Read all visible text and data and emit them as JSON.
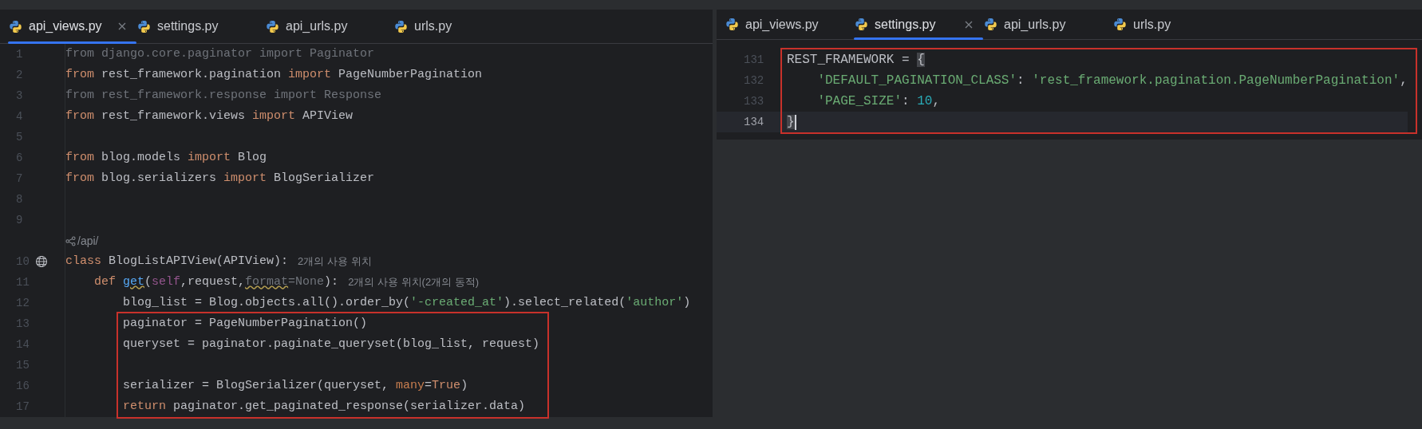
{
  "panes": [
    {
      "tabs": [
        {
          "label": "api_views.py",
          "selected": true
        },
        {
          "label": "settings.py",
          "selected": false
        },
        {
          "label": "api_urls.py",
          "selected": false
        },
        {
          "label": "urls.py",
          "selected": false
        }
      ],
      "lines": [
        {
          "kind": "code",
          "number": "1",
          "boxed": false,
          "tokens": [
            {
              "kind": "unused",
              "text": "from django.core.paginator import Paginator"
            }
          ]
        },
        {
          "kind": "code",
          "number": "2",
          "boxed": false,
          "tokens": [
            {
              "kind": "kw",
              "text": "from"
            },
            {
              "kind": "plain",
              "text": " rest_framework.pagination "
            },
            {
              "kind": "kw",
              "text": "import"
            },
            {
              "kind": "plain",
              "text": " PageNumberPagination"
            }
          ]
        },
        {
          "kind": "code",
          "number": "3",
          "boxed": false,
          "tokens": [
            {
              "kind": "unused",
              "text": "from rest_framework.response import Response"
            }
          ]
        },
        {
          "kind": "code",
          "number": "4",
          "boxed": false,
          "tokens": [
            {
              "kind": "kw",
              "text": "from"
            },
            {
              "kind": "plain",
              "text": " rest_framework.views "
            },
            {
              "kind": "kw",
              "text": "import"
            },
            {
              "kind": "plain",
              "text": " APIView"
            }
          ]
        },
        {
          "kind": "code",
          "number": "5",
          "boxed": false
        },
        {
          "kind": "code",
          "number": "6",
          "boxed": false,
          "tokens": [
            {
              "kind": "kw",
              "text": "from"
            },
            {
              "kind": "plain",
              "text": " blog.models "
            },
            {
              "kind": "kw",
              "text": "import"
            },
            {
              "kind": "plain",
              "text": " Blog"
            }
          ]
        },
        {
          "kind": "code",
          "number": "7",
          "boxed": false,
          "tokens": [
            {
              "kind": "kw",
              "text": "from"
            },
            {
              "kind": "plain",
              "text": " blog.serializers "
            },
            {
              "kind": "kw",
              "text": "import"
            },
            {
              "kind": "plain",
              "text": " BlogSerializer"
            }
          ]
        },
        {
          "kind": "code",
          "number": "8",
          "boxed": false
        },
        {
          "kind": "code",
          "number": "9",
          "boxed": false
        },
        {
          "kind": "route",
          "boxed": false,
          "text": "/api/"
        },
        {
          "kind": "endpoint",
          "number": "10",
          "boxed": false,
          "tokens": [
            {
              "kind": "kw",
              "text": "class"
            },
            {
              "kind": "plain",
              "text": " BlogListAPIView(APIView):"
            }
          ],
          "hint": "2개의 사용 위치"
        },
        {
          "kind": "code",
          "number": "11",
          "boxed": false,
          "tokens": [
            {
              "kind": "kw",
              "text": "    def "
            },
            {
              "kind": "warn_call",
              "text": "get"
            },
            {
              "kind": "plain",
              "text": "("
            },
            {
              "kind": "self",
              "text": "self"
            },
            {
              "kind": "plain",
              "text": ",request,"
            },
            {
              "kind": "warn_param",
              "text": "format"
            },
            {
              "kind": "unused",
              "text": "=None"
            },
            {
              "kind": "plain",
              "text": "):"
            }
          ],
          "hint": "2개의 사용 위치(2개의 동적)"
        },
        {
          "kind": "code",
          "number": "12",
          "boxed": false,
          "tokens": [
            {
              "kind": "plain",
              "text": "        blog_list = Blog.objects.all().order_by("
            },
            {
              "kind": "str",
              "text": "'-created_at'"
            },
            {
              "kind": "plain",
              "text": ").select_related("
            },
            {
              "kind": "str",
              "text": "'author'"
            },
            {
              "kind": "plain",
              "text": ")"
            }
          ]
        },
        {
          "kind": "code",
          "number": "13",
          "boxed": true,
          "tokens": [
            {
              "kind": "plain",
              "text": "        paginator = PageNumberPagination()"
            }
          ]
        },
        {
          "kind": "code",
          "number": "14",
          "boxed": true,
          "tokens": [
            {
              "kind": "plain",
              "text": "        queryset = paginator.paginate_queryset(blog_list, request)"
            }
          ]
        },
        {
          "kind": "code",
          "number": "15",
          "boxed": true
        },
        {
          "kind": "code",
          "number": "16",
          "boxed": true,
          "tokens": [
            {
              "kind": "plain",
              "text": "        serializer = BlogSerializer(queryset, "
            },
            {
              "kind": "kwarg",
              "text": "many"
            },
            {
              "kind": "plain",
              "text": "="
            },
            {
              "kind": "kw",
              "text": "True"
            },
            {
              "kind": "plain",
              "text": ")"
            }
          ]
        },
        {
          "kind": "code",
          "number": "17",
          "boxed": true,
          "tokens": [
            {
              "kind": "kw",
              "text": "        return"
            },
            {
              "kind": "plain",
              "text": " paginator.get_paginated_response(serializer.data)"
            }
          ]
        }
      ]
    },
    {
      "tabs": [
        {
          "label": "api_views.py",
          "selected": false
        },
        {
          "label": "settings.py",
          "selected": true
        },
        {
          "label": "api_urls.py",
          "selected": false
        },
        {
          "label": "urls.py",
          "selected": false
        }
      ],
      "lines": [
        {
          "kind": "code",
          "number": "131",
          "boxed": true,
          "current": false,
          "tokens": [
            {
              "kind": "plain",
              "text": "REST_FRAMEWORK = "
            },
            {
              "kind": "brace_match",
              "text": "{"
            }
          ]
        },
        {
          "kind": "code",
          "number": "132",
          "boxed": true,
          "current": false,
          "tokens": [
            {
              "kind": "str",
              "text": "    'DEFAULT_PAGINATION_CLASS'"
            },
            {
              "kind": "plain",
              "text": ": "
            },
            {
              "kind": "str",
              "text": "'rest_framework.pagination.PageNumberPagination'"
            },
            {
              "kind": "plain",
              "text": ","
            }
          ]
        },
        {
          "kind": "code",
          "number": "133",
          "boxed": true,
          "current": false,
          "tokens": [
            {
              "kind": "str",
              "text": "    'PAGE_SIZE'"
            },
            {
              "kind": "plain",
              "text": ": "
            },
            {
              "kind": "num",
              "text": "10"
            },
            {
              "kind": "plain",
              "text": ","
            }
          ]
        },
        {
          "kind": "code",
          "number": "134",
          "boxed": true,
          "current": true,
          "tokens": [
            {
              "kind": "brace_match",
              "text": "}"
            }
          ]
        }
      ]
    }
  ]
}
